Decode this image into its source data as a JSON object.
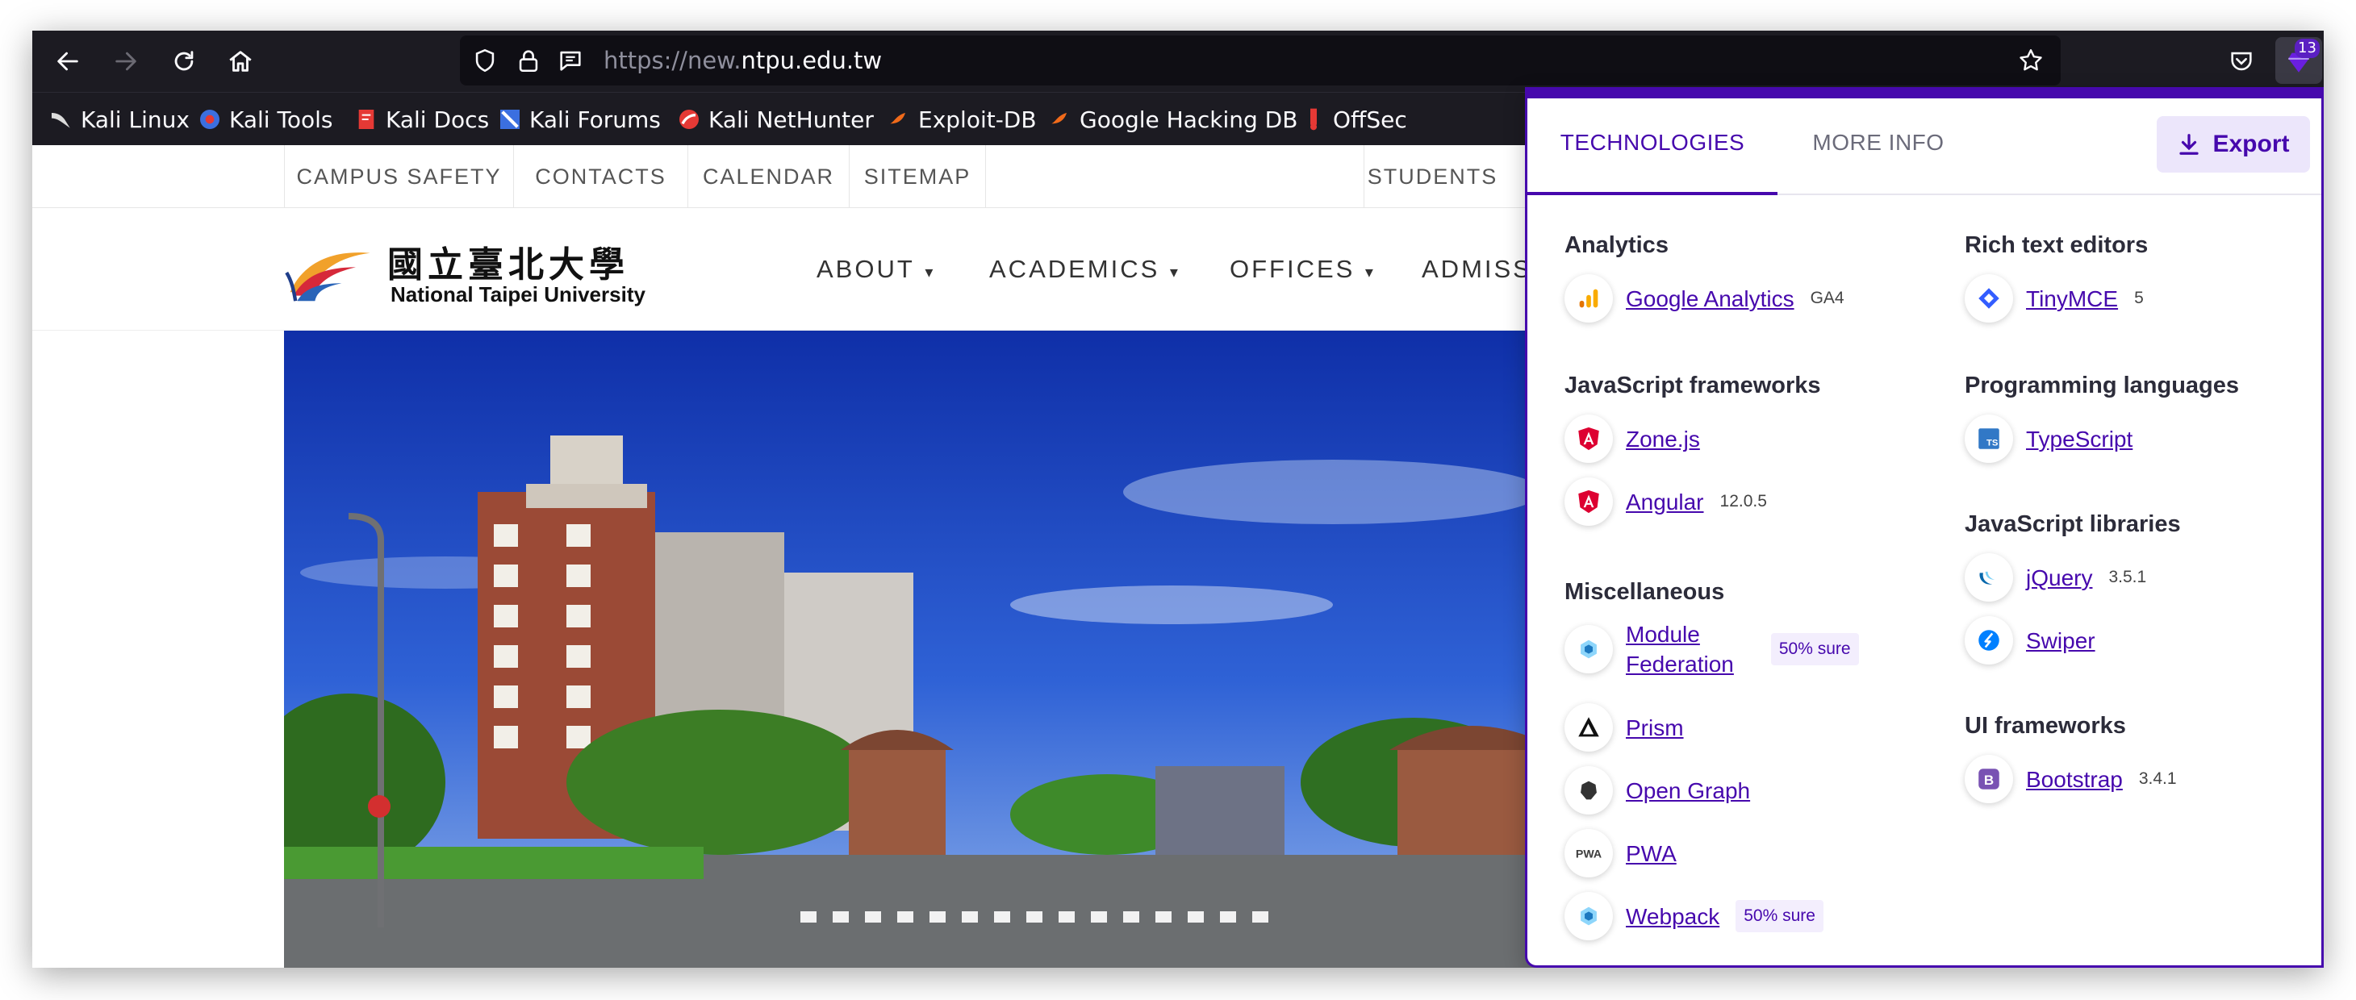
{
  "browser": {
    "url_prefix": "https://new.",
    "url_domain": "ntpu.edu.tw",
    "extension_badge": "13",
    "bookmarks": [
      {
        "label": "Kali Linux",
        "icon": "kali-dragon-icon"
      },
      {
        "label": "Kali Tools",
        "icon": "kali-tools-icon"
      },
      {
        "label": "Kali Docs",
        "icon": "kali-docs-icon"
      },
      {
        "label": "Kali Forums",
        "icon": "kali-forums-icon"
      },
      {
        "label": "Kali NetHunter",
        "icon": "nethunter-icon"
      },
      {
        "label": "Exploit-DB",
        "icon": "exploit-db-icon"
      },
      {
        "label": "Google Hacking DB",
        "icon": "ghdb-icon"
      },
      {
        "label": "OffSec",
        "icon": "offsec-icon"
      }
    ]
  },
  "site": {
    "top_links": [
      "CAMPUS SAFETY",
      "CONTACTS",
      "CALENDAR",
      "SITEMAP",
      "STUDENTS"
    ],
    "logo_chinese": "國立臺北大學",
    "logo_english": "National Taipei University",
    "nav": [
      "ABOUT",
      "ACADEMICS",
      "OFFICES",
      "ADMISS"
    ]
  },
  "popup": {
    "tabs": [
      "TECHNOLOGIES",
      "MORE INFO"
    ],
    "export_label": "Export",
    "categories": {
      "analytics": {
        "title": "Analytics",
        "items": [
          {
            "name": "Google Analytics",
            "version": "GA4"
          }
        ]
      },
      "js_frameworks": {
        "title": "JavaScript frameworks",
        "items": [
          {
            "name": "Zone.js"
          },
          {
            "name": "Angular",
            "version": "12.0.5"
          }
        ]
      },
      "misc": {
        "title": "Miscellaneous",
        "items": [
          {
            "name_line1": "Module",
            "name_line2": "Federation",
            "confidence": "50% sure"
          },
          {
            "name": "Prism"
          },
          {
            "name": "Open Graph"
          },
          {
            "name": "PWA"
          },
          {
            "name": "Webpack",
            "confidence": "50% sure"
          }
        ]
      },
      "rich_text": {
        "title": "Rich text editors",
        "items": [
          {
            "name": "TinyMCE",
            "version": "5"
          }
        ]
      },
      "prog_lang": {
        "title": "Programming languages",
        "items": [
          {
            "name": "TypeScript"
          }
        ]
      },
      "js_libs": {
        "title": "JavaScript libraries",
        "items": [
          {
            "name": "jQuery",
            "version": "3.5.1"
          },
          {
            "name": "Swiper"
          }
        ]
      },
      "ui_frameworks": {
        "title": "UI frameworks",
        "items": [
          {
            "name": "Bootstrap",
            "version": "3.4.1"
          }
        ]
      }
    }
  },
  "colors": {
    "accent": "#4608ad",
    "browser_bg": "#1c1b22"
  }
}
